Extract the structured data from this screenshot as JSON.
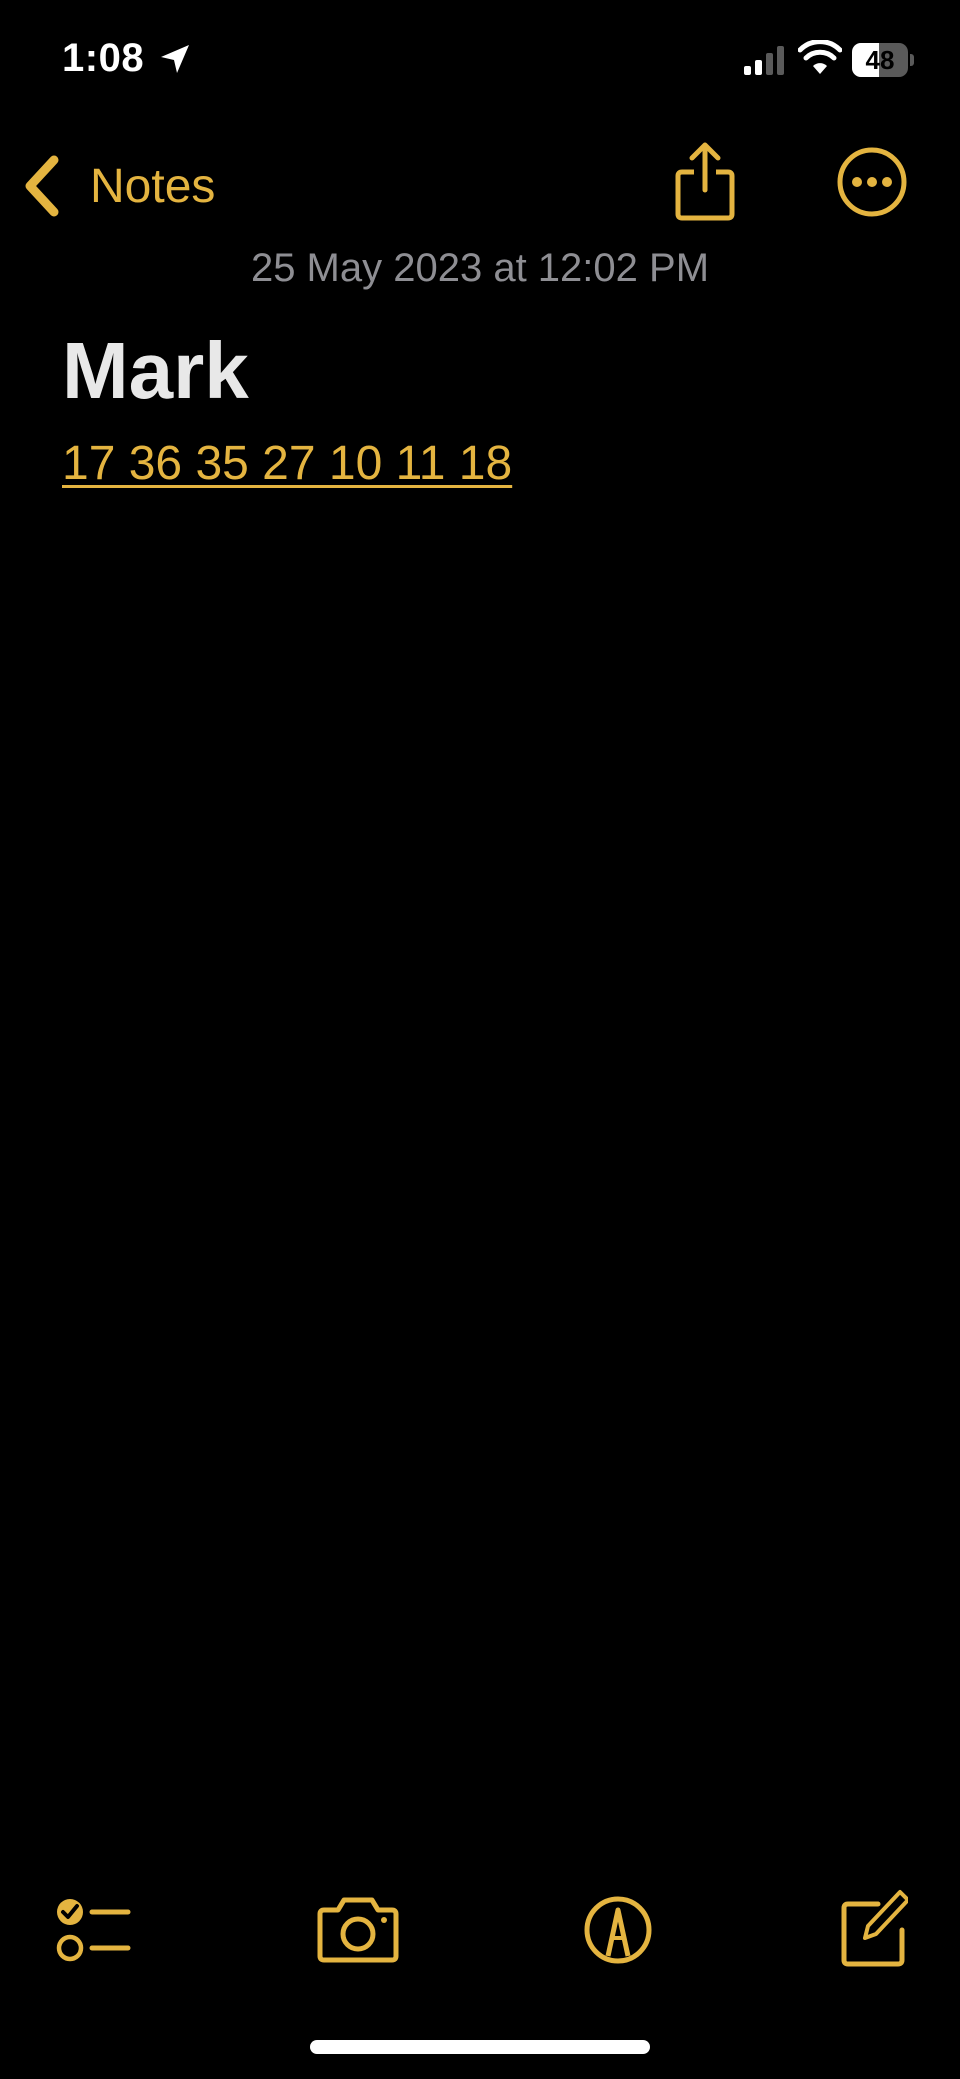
{
  "status_bar": {
    "time": "1:08",
    "battery_level": "48",
    "battery_fraction": 0.48
  },
  "nav": {
    "back_label": "Notes"
  },
  "note": {
    "date": "25 May 2023 at 12:02 PM",
    "title": "Mark",
    "body": "17 36 35 27 10 11 18"
  },
  "icons": {
    "location": "location-arrow-icon",
    "signal": "cellular-signal-icon",
    "wifi": "wifi-icon",
    "back": "chevron-left-icon",
    "share": "share-icon",
    "more": "ellipsis-circle-icon",
    "checklist": "checklist-icon",
    "camera": "camera-icon",
    "markup": "pen-tip-circle-icon",
    "compose": "compose-icon"
  },
  "colors": {
    "accent": "#e4b440",
    "background": "#000000",
    "date_text": "#8e8e93",
    "title_text": "#e8e8e8"
  }
}
